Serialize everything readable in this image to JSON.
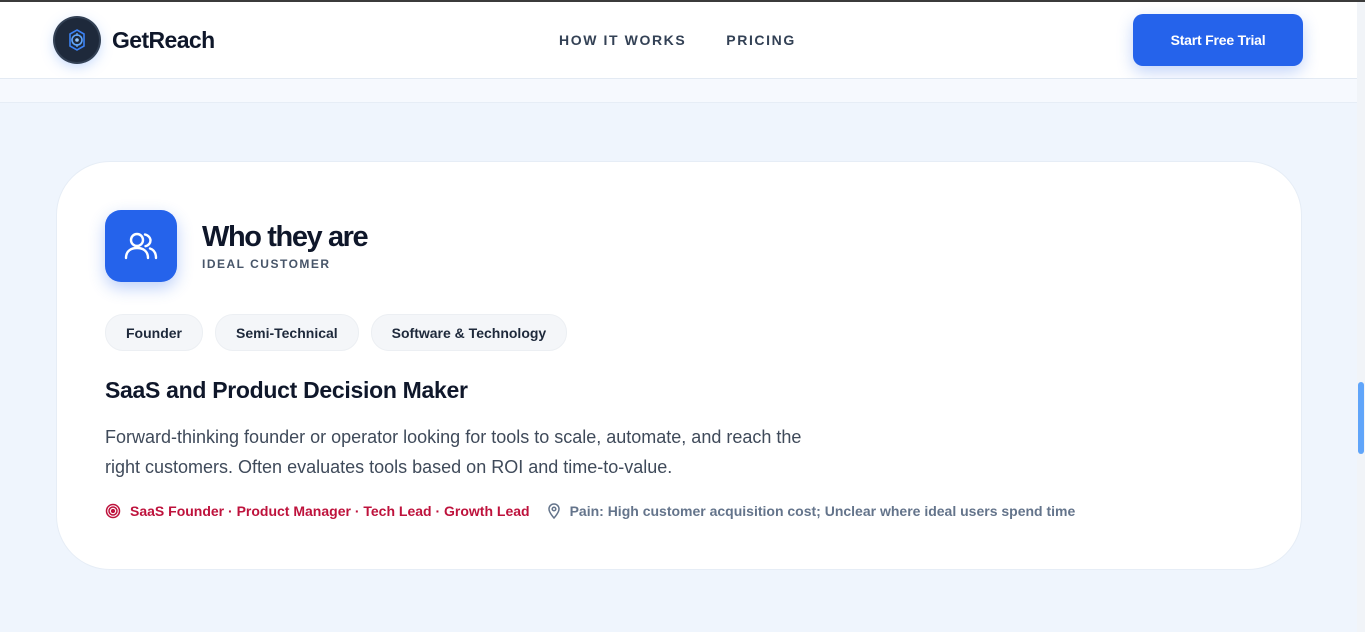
{
  "brand": {
    "name": "GetReach",
    "logo_icon": "target-lens-icon"
  },
  "nav": {
    "items": [
      {
        "label": "HOW IT WORKS"
      },
      {
        "label": "PRICING"
      }
    ]
  },
  "cta": {
    "label": "Start Free Trial"
  },
  "card": {
    "icon": "users-icon",
    "title": "Who they are",
    "eyebrow": "IDEAL CUSTOMER",
    "tags": [
      "Founder",
      "Semi-Technical",
      "Software & Technology"
    ],
    "persona_title": "SaaS and Product Decision Maker",
    "description_line1": "Forward-thinking founder or operator looking for tools to scale, automate, and reach the",
    "description_line2": "right customers. Often evaluates tools based on ROI and time-to-value.",
    "roles": "SaaS Founder · Product Manager · Tech Lead · Growth Lead",
    "roles_icon": "target-icon",
    "pain": "Pain: High customer acquisition cost; Unclear where ideal users spend time",
    "pain_icon": "map-pin-icon"
  },
  "colors": {
    "accent": "#2563eb",
    "background": "#eff5fd",
    "roles_text": "#be123c",
    "muted_text": "#64748b"
  }
}
